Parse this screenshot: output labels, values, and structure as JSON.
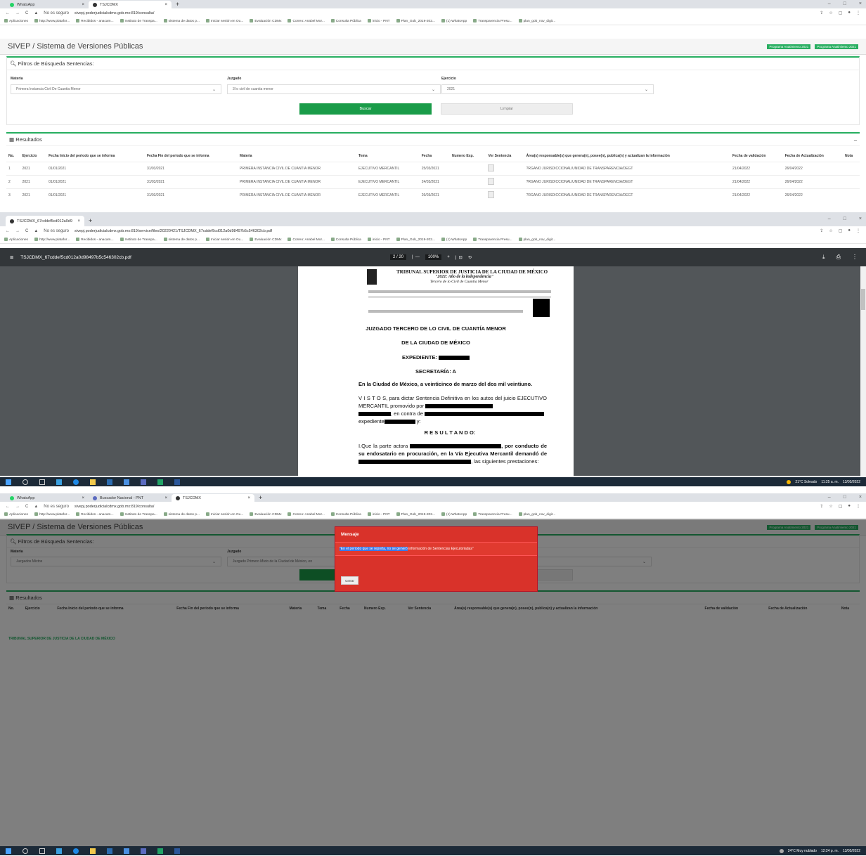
{
  "top": {
    "tabs": [
      {
        "label": "WhatsApp"
      },
      {
        "label": "TSJCDMX"
      }
    ],
    "url_prefix": "No es seguro",
    "url": "sivepj.poderjudicialcdmx.gob.mx:819/consulta/",
    "bookmarks": [
      "Aplicaciones",
      "http://www.platafor...",
      "Recibidos - anacam...",
      "Instituto de Transpa...",
      "sistema de datos p...",
      "Iniciar sesión en Ou...",
      "Evaluación CDMx",
      "Correo: Anabel Mor...",
      "Consulta Pública",
      "inicio - PNT",
      "Plan_Gob_2019-202...",
      "(1) WhatsApp",
      "Transparencia Presu...",
      "plan_gob_nov_digit..."
    ],
    "app_title": "SIVEP / Sistema de Versiones Públicas",
    "program_badges": [
      "Programa Anatimiento 2021",
      "Programa Anatimiento 2021"
    ],
    "filters": {
      "title": "Filtros de Búsqueda Sentencias:",
      "materia_label": "Materia",
      "materia_value": "Primera Instancia Civil De Cuantia Menor",
      "juzgado_label": "Juzgado",
      "juzgado_value": "3 lo civil de cuantia menor",
      "ejercicio_label": "Ejercicio",
      "ejercicio_value": "2021",
      "search_label": "Buscar",
      "clear_label": "Limpiar"
    },
    "results": {
      "title": "Resultados",
      "columns": [
        "No.",
        "Ejercicio",
        "Fecha Inicio del periodo que se informa",
        "Fecha Fin del periodo que se informa",
        "Materia",
        "Tema",
        "Fecha",
        "Numero Exp.",
        "Ver Sentencia",
        "Área(s) responsable(s) que genera(n), posee(n), publica(n) y actualizan la información",
        "Fecha de validación",
        "Fecha de Actualización",
        "Nota"
      ],
      "rows": [
        [
          "1",
          "2021",
          "01/01/2021",
          "31/03/2021",
          "PRIMERA INSTANCIA CIVIL DE CUANTIA MENOR",
          "EJECUTIVO MERCANTIL",
          "25/03/2021",
          "",
          "",
          "?RGANO JURISDICCIONAL/UNIDAD DE TRANSPARENCIA/DEGT",
          "21/04/2022",
          "26/04/2022",
          ""
        ],
        [
          "2",
          "2021",
          "01/01/2021",
          "31/03/2021",
          "PRIMERA INSTANCIA CIVIL DE CUANTIA MENOR",
          "EJECUTIVO MERCANTIL",
          "24/03/2021",
          "",
          "",
          "?RGANO JURISDICCIONAL/UNIDAD DE TRANSPARENCIA/DEGT",
          "21/04/2022",
          "26/04/2022",
          ""
        ],
        [
          "3",
          "2021",
          "01/01/2021",
          "31/03/2021",
          "PRIMERA INSTANCIA CIVIL DE CUANTIA MENOR",
          "EJECUTIVO MERCANTIL",
          "26/03/2021",
          "",
          "",
          "?RGANO JURISDICCIONAL/UNIDAD DE TRANSPARENCIA/DEGT",
          "21/04/2022",
          "26/04/2022",
          ""
        ]
      ]
    }
  },
  "pdf": {
    "tab_label": "TSJCDMX_67cddef5cd012a0d9",
    "url": "sivepj.poderjudicialcdmx.gob.mx:819/service/files/20220421/TSJCDMX_67cddef5cd012a0d98497b5c546302cb.pdf",
    "file_name": "TSJCDMX_67cddef5cd012a0d98497b5c546302cb.pdf",
    "page_indicator": "2 / 20",
    "zoom": "100%",
    "header_title": "TRIBUNAL SUPERIOR DE JUSTICIA DE LA CIUDAD DE MÉXICO",
    "header_sub1": "\"2021: Año de la independencia\"",
    "header_sub2": "Tercero de lo Civil de Cuantía Menor",
    "heading1": "JUZGADO TERCERO DE LO CIVIL DE CUANTÍA MENOR",
    "heading2": "DE LA CIUDAD DE MÉXICO",
    "expediente_label": "EXPEDIENTE:",
    "secretaria": "SECRETARÍA: A",
    "date_line": "En la Ciudad de México, a veinticinco de marzo del dos mil veintiuno.",
    "vistos": "V I S T O S, para dictar Sentencia Definitiva en los autos del juicio EJECUTIVO MERCANTIL promovido por",
    "vistos2": ", en contra de",
    "vistos3": "expediente",
    "resultando": "R E S U L T A N D O:",
    "p1a": "I.Que la parte actora",
    "p1b": ", por conducto de su endosatario en procuración, en la Vía Ejecutiva Mercantil demandó de",
    "p1c": ", las siguientes prestaciones:"
  },
  "taskbar1": {
    "weather": "21°C Soleado",
    "time": "11:25 a. m.",
    "date": "13/05/2022"
  },
  "bottom": {
    "tabs": [
      {
        "label": "WhatsApp"
      },
      {
        "label": "Buscador Nacional - PNT"
      },
      {
        "label": "TSJCDMX"
      }
    ],
    "url": "sivepj.poderjudicialcdmx.gob.mx:819/consulta/",
    "app_title": "SIVEP / Sistema de Versiones Públicas",
    "filters_title": "Filtros de Búsqueda Sentencias:",
    "materia_label": "Materia",
    "materia_value": "Juzgados Mixtos",
    "juzgado_label": "Juzgado",
    "juzgado_value": "Juzgado Primero Mixto de la Ciudad de México, en",
    "results_title": "Resultados",
    "columns": [
      "No.",
      "Ejercicio",
      "Fecha Inicio del periodo que se informa",
      "Fecha Fin del periodo que se informa",
      "Materia",
      "Tema",
      "Fecha",
      "Numero Exp.",
      "Ver Sentencia",
      "Área(s) responsable(s) que genera(n), posee(n), publica(n) y actualizan la información",
      "Fecha de validación",
      "Fecha de Actualización",
      "Nota"
    ],
    "footer_text": "TRIBUNAL SUPERIOR DE JUSTICIA DE LA CIUDAD DE MÉXICO",
    "modal_title": "Mensaje",
    "modal_msg_selected": "\"En el periodo que se reporta, no se generó",
    "modal_msg_rest": " información de Sentencias Ejecutoriadas\"",
    "modal_close": "Cerrar"
  },
  "taskbar2": {
    "weather": "24°C Muy nublado",
    "time": "12:24 p. m.",
    "date": "13/05/2022"
  },
  "colors": {
    "green": "#1a9c49",
    "modal_red": "#d9322a",
    "pdf_toolbar": "#323639",
    "taskbar": "#1c2a38"
  }
}
